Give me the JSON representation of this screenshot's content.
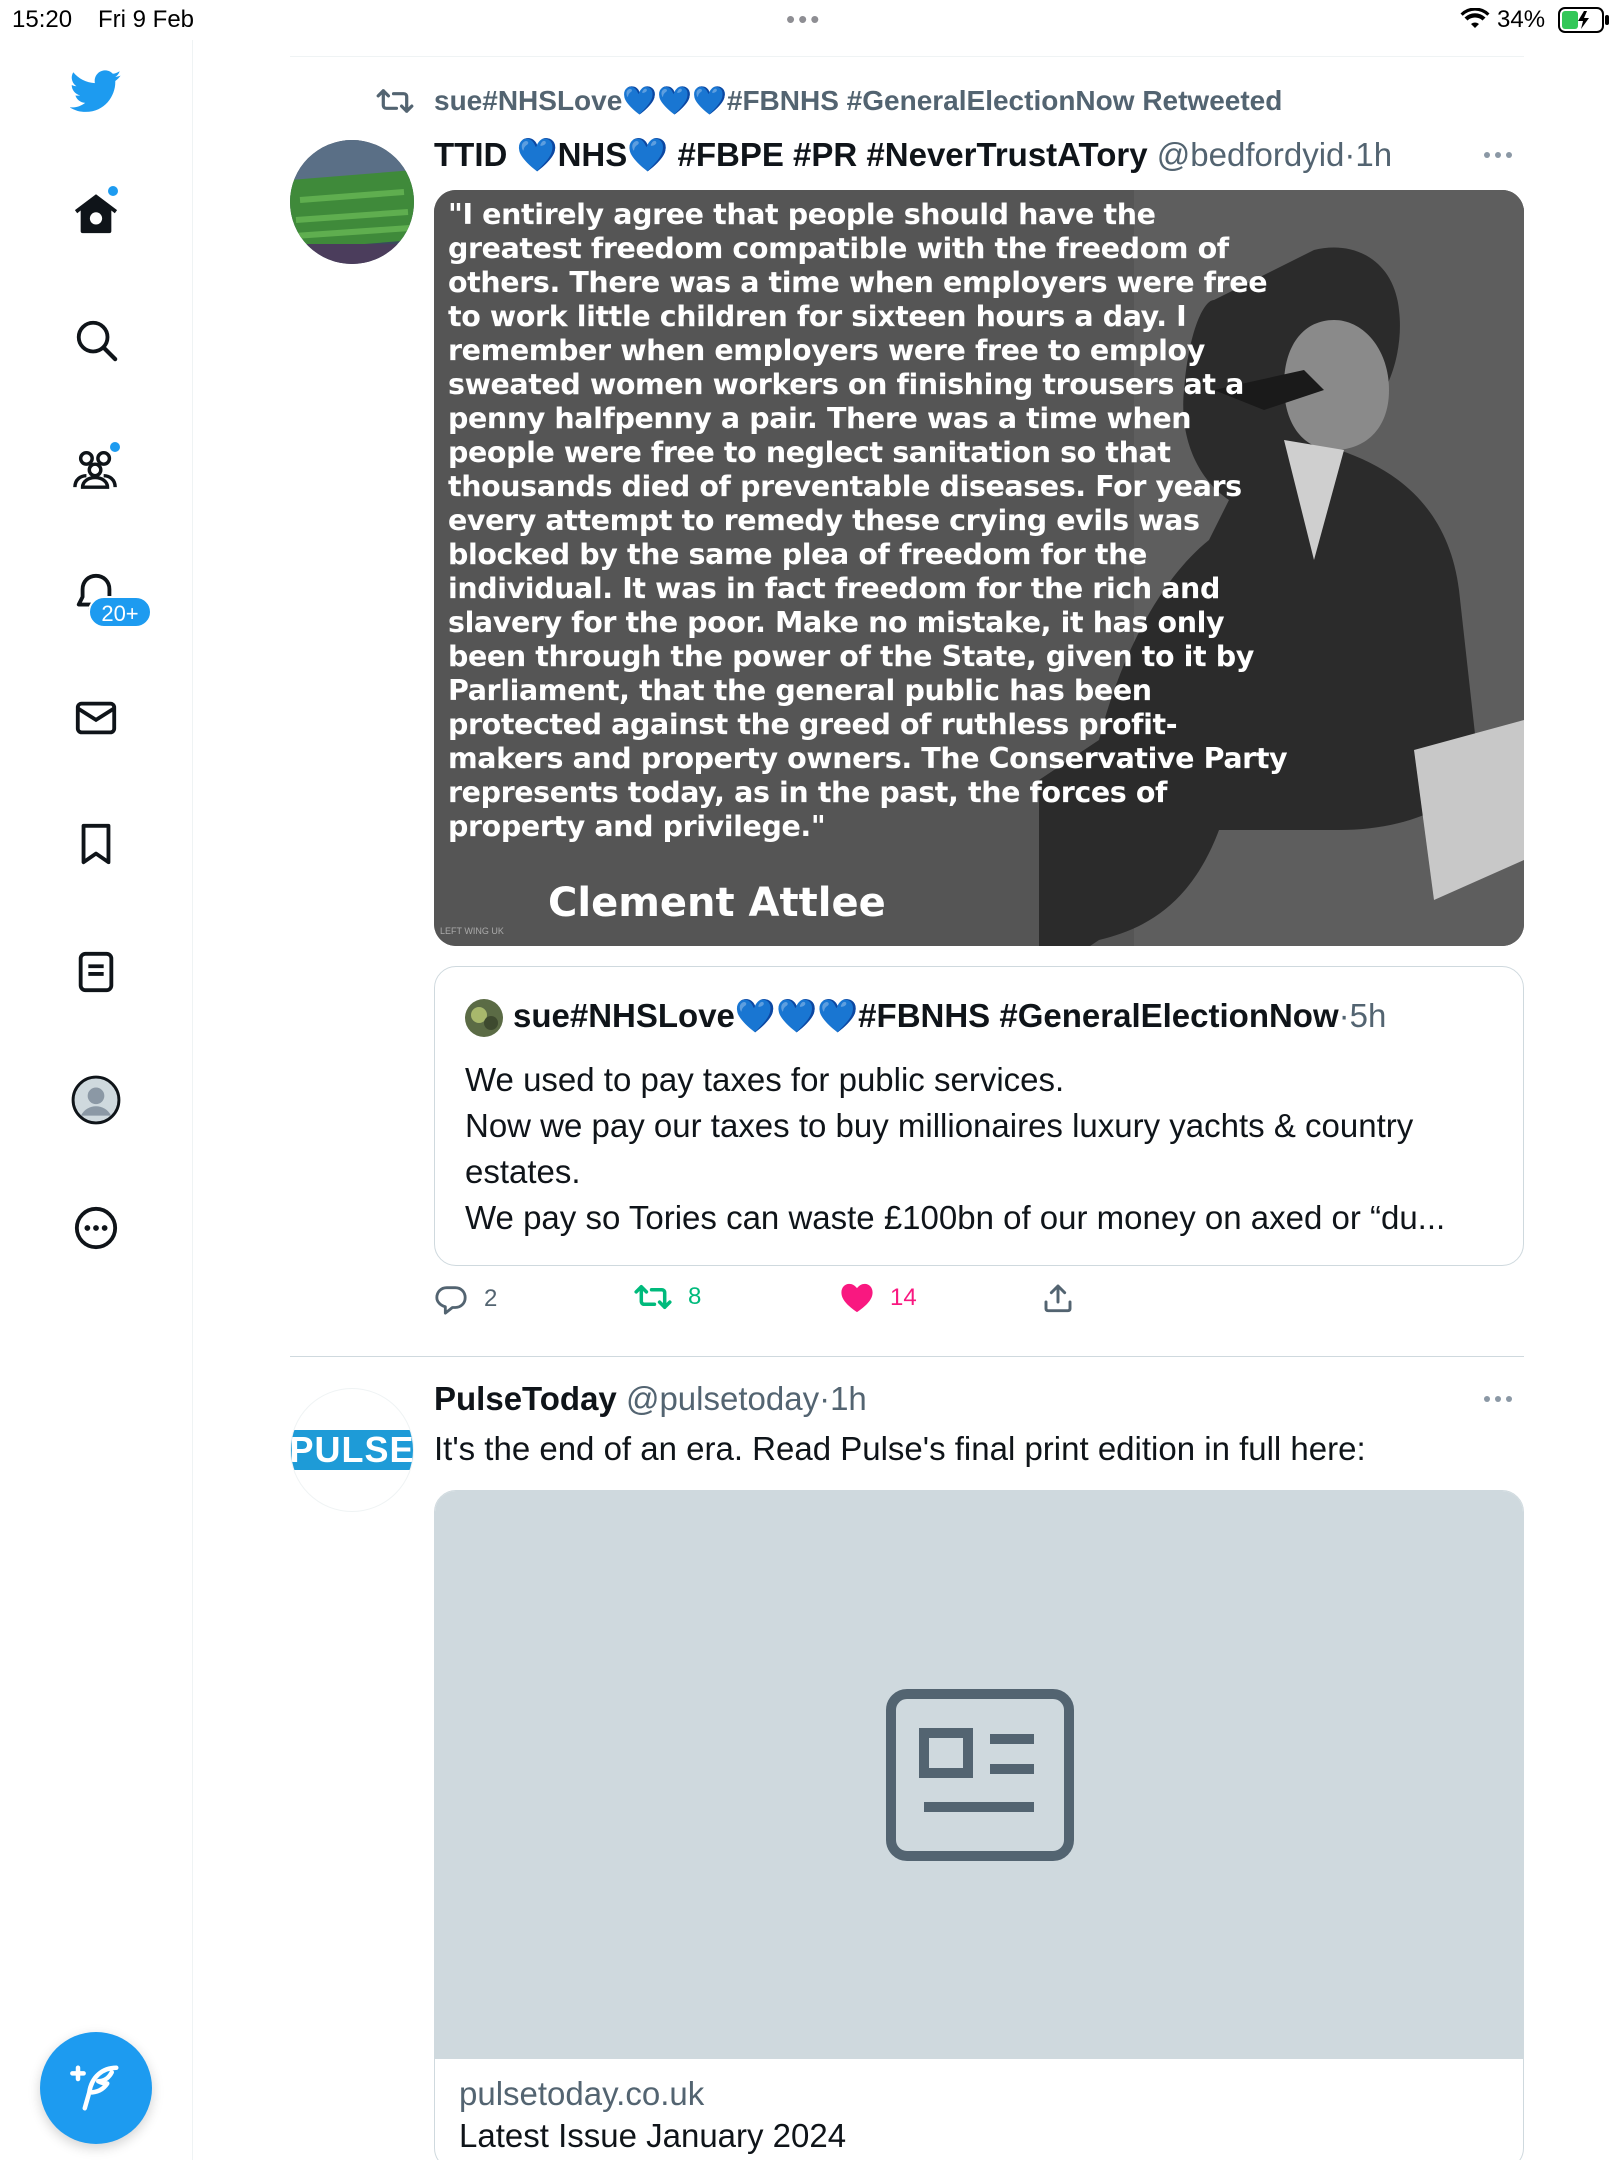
{
  "status_bar": {
    "time": "15:20",
    "date": "Fri 9 Feb",
    "battery_percent": "34%"
  },
  "sidebar": {
    "notifications_badge": "20+",
    "accent_color": "#1d9bf0"
  },
  "tweet1": {
    "retweeted_by": "sue#NHSLove💙💙💙#FBNHS #GeneralElectionNow Retweeted",
    "author_name": "TTID 💙NHS💙 #FBPE #PR #NeverTrustATory",
    "author_handle": "@bedfordyid",
    "separator": "·",
    "time": "1h",
    "image_quote": "\"I entirely agree that people should have the greatest freedom compatible with the freedom of others. There was a time when employers were free to work little children for sixteen hours a day. I remember when employers were free to employ sweated women workers on finishing trousers at a penny halfpenny a pair. There was a time when people were free to neglect sanitation so that thousands died of preventable diseases. For years every attempt to remedy these crying evils was blocked by the same plea of freedom for the individual. It was in fact freedom for the rich and slavery for the poor. Make no mistake, it has only been through the power of the State, given to it by Parliament, that the general public has been protected against the greed of ruthless profit-makers and property owners. The Conservative Party represents today, as in the past, the forces of property and privilege.\"",
    "image_author": "Clement Attlee",
    "image_watermark": "LEFT WING UK",
    "quoted": {
      "author_name": "sue#NHSLove💙💙💙#FBNHS #GeneralElectionNow",
      "separator": "·",
      "time": "5h",
      "lines": [
        "We used to pay taxes for public services.",
        "Now we pay our taxes to buy millionaires luxury yachts & country",
        "estates.",
        "We pay so Tories can waste £100bn of our money on axed or “du..."
      ]
    },
    "actions": {
      "replies": "2",
      "retweets": "8",
      "likes": "14"
    }
  },
  "tweet2": {
    "author_name": "PulseToday",
    "author_handle": "@pulsetoday",
    "separator": "·",
    "time": "1h",
    "avatar_text": "PULSE",
    "text": "It's the end of an era. Read Pulse's final print edition in full here:",
    "card": {
      "domain": "pulsetoday.co.uk",
      "title": "Latest Issue January 2024"
    }
  }
}
